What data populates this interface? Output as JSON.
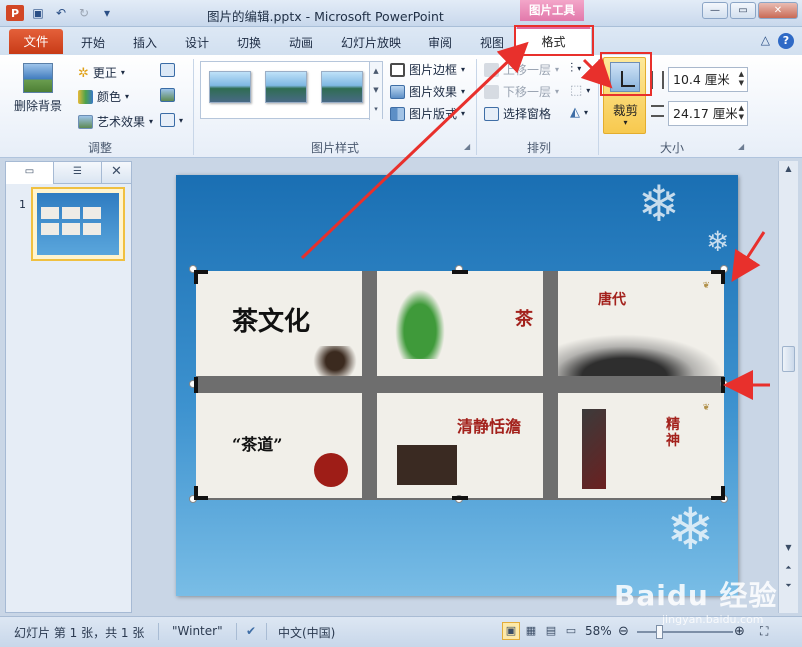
{
  "window": {
    "title": "图片的编辑.pptx - Microsoft PowerPoint",
    "context_tab_group": "图片工具"
  },
  "tabs": {
    "file": "文件",
    "items": [
      "开始",
      "插入",
      "设计",
      "切换",
      "动画",
      "幻灯片放映",
      "审阅",
      "视图"
    ],
    "active": "格式"
  },
  "ribbon": {
    "adjust": {
      "remove_bg": "删除背景",
      "corrections": "更正",
      "color": "颜色",
      "artistic": "艺术效果",
      "group_label": "调整"
    },
    "picture_styles": {
      "border": "图片边框",
      "effects": "图片效果",
      "layout": "图片版式",
      "group_label": "图片样式"
    },
    "arrange": {
      "bring_forward": "上移一层",
      "send_backward": "下移一层",
      "selection_pane": "选择窗格",
      "group_label": "排列"
    },
    "size": {
      "crop": "裁剪",
      "height": "10.4 厘米",
      "width": "24.17 厘米",
      "group_label": "大小"
    }
  },
  "slides_pane": {
    "slide_number": "1"
  },
  "slide_content": {
    "cells": [
      {
        "text": "茶文化"
      },
      {
        "text": "茶"
      },
      {
        "text": "唐代"
      },
      {
        "text": "“茶道”"
      },
      {
        "text": "清静恬澹"
      },
      {
        "text": "精神"
      }
    ]
  },
  "statusbar": {
    "slide_info": "幻灯片 第 1 张，共 1 张",
    "theme": "\"Winter\"",
    "language": "中文(中国)",
    "zoom": "58%"
  },
  "watermark": {
    "text": "Baidu 经验",
    "sub": "jingyan.baidu.com"
  },
  "colors": {
    "file_tab": "#c83b17",
    "context_tab": "#e279ab",
    "annotation_red": "#e8302c",
    "crop_active": "#f7c94f"
  }
}
